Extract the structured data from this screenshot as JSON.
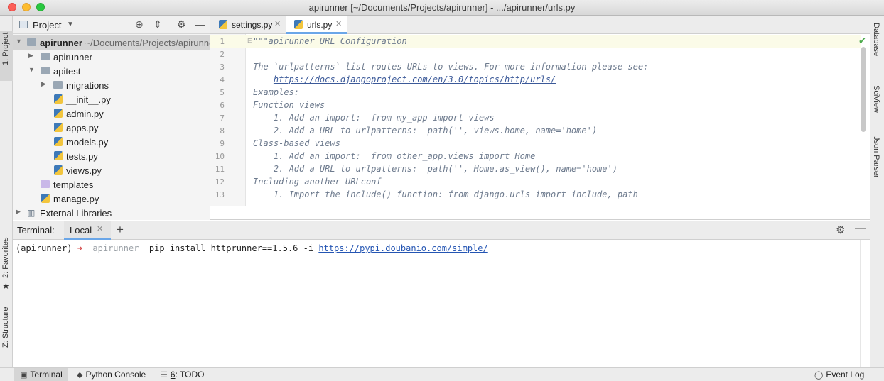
{
  "window": {
    "title": "apirunner [~/Documents/Projects/apirunner] - .../apirunner/urls.py"
  },
  "left_strip": {
    "project_tab": "1: Project",
    "favorites_tab": "2: Favorites",
    "structure_tab": "Z: Structure"
  },
  "right_strip": {
    "database_tab": "Database",
    "sciview_tab": "SciView",
    "json_parser_tab": "Json Parser"
  },
  "project_panel": {
    "header_label": "Project",
    "tree": [
      {
        "name": "apirunner",
        "path": "~/Documents/Projects/apirunner",
        "kind": "root",
        "depth": 0,
        "expanded": true
      },
      {
        "name": "apirunner",
        "kind": "folder",
        "depth": 1,
        "expanded": false
      },
      {
        "name": "apitest",
        "kind": "folder",
        "depth": 1,
        "expanded": true
      },
      {
        "name": "migrations",
        "kind": "folder",
        "depth": 2,
        "expanded": false
      },
      {
        "name": "__init__.py",
        "kind": "python",
        "depth": 2
      },
      {
        "name": "admin.py",
        "kind": "python",
        "depth": 2
      },
      {
        "name": "apps.py",
        "kind": "python",
        "depth": 2
      },
      {
        "name": "models.py",
        "kind": "python",
        "depth": 2
      },
      {
        "name": "tests.py",
        "kind": "python",
        "depth": 2
      },
      {
        "name": "views.py",
        "kind": "python",
        "depth": 2
      },
      {
        "name": "templates",
        "kind": "template-folder",
        "depth": 1
      },
      {
        "name": "manage.py",
        "kind": "python",
        "depth": 1
      },
      {
        "name": "External Libraries",
        "kind": "library",
        "depth": 0,
        "expanded": false
      }
    ]
  },
  "editor": {
    "tabs": [
      {
        "label": "settings.py",
        "active": false
      },
      {
        "label": "urls.py",
        "active": true
      }
    ],
    "lines": [
      {
        "n": "1",
        "text": "\"\"\"apirunner URL Configuration"
      },
      {
        "n": "2",
        "text": ""
      },
      {
        "n": "3",
        "text": "The `urlpatterns` list routes URLs to views. For more information please see:"
      },
      {
        "n": "4",
        "text": "    ",
        "link": "https://docs.djangoproject.com/en/3.0/topics/http/urls/"
      },
      {
        "n": "5",
        "text": "Examples:"
      },
      {
        "n": "6",
        "text": "Function views"
      },
      {
        "n": "7",
        "text": "    1. Add an import:  from my_app import views"
      },
      {
        "n": "8",
        "text": "    2. Add a URL to urlpatterns:  path('', views.home, name='home')"
      },
      {
        "n": "9",
        "text": "Class-based views"
      },
      {
        "n": "10",
        "text": "    1. Add an import:  from other_app.views import Home"
      },
      {
        "n": "11",
        "text": "    2. Add a URL to urlpatterns:  path('', Home.as_view(), name='home')"
      },
      {
        "n": "12",
        "text": "Including another URLconf"
      },
      {
        "n": "13",
        "text": "    1. Import the include() function: from django.urls import include, path"
      }
    ]
  },
  "terminal": {
    "label": "Terminal:",
    "tab": "Local",
    "prompt_env": "(apirunner)",
    "prompt_arrow": "➜",
    "prompt_dir": "apirunner",
    "command": "pip install httprunner==1.5.6 -i",
    "command_url": "https://pypi.doubanio.com/simple/"
  },
  "statusbar": {
    "terminal": "Terminal",
    "python_console": "Python Console",
    "todo_prefix": "6",
    "todo_label": ": TODO",
    "event_log": "Event Log"
  },
  "colors": {
    "accent_tab": "#6aa6e8",
    "comment": "#6e7b8e",
    "link": "#3c5a99",
    "prompt_arrow": "#d64d4d"
  }
}
